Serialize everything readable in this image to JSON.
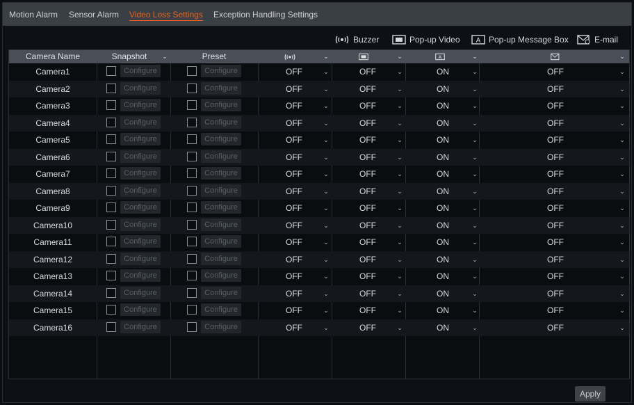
{
  "tabs": [
    "Motion Alarm",
    "Sensor Alarm",
    "Video Loss Settings",
    "Exception Handling Settings"
  ],
  "legend": {
    "buzzer": "Buzzer",
    "popup_video": "Pop-up Video",
    "popup_message": "Pop-up Message Box",
    "email": "E-mail"
  },
  "table": {
    "headers": {
      "camera": "Camera Name",
      "snapshot": "Snapshot",
      "preset": "Preset"
    },
    "configure_label": "Configure",
    "rows": [
      {
        "name": "Camera1",
        "buzzer": "OFF",
        "popup_video": "OFF",
        "popup_msg": "ON",
        "email": "OFF"
      },
      {
        "name": "Camera2",
        "buzzer": "OFF",
        "popup_video": "OFF",
        "popup_msg": "ON",
        "email": "OFF"
      },
      {
        "name": "Camera3",
        "buzzer": "OFF",
        "popup_video": "OFF",
        "popup_msg": "ON",
        "email": "OFF"
      },
      {
        "name": "Camera4",
        "buzzer": "OFF",
        "popup_video": "OFF",
        "popup_msg": "ON",
        "email": "OFF"
      },
      {
        "name": "Camera5",
        "buzzer": "OFF",
        "popup_video": "OFF",
        "popup_msg": "ON",
        "email": "OFF"
      },
      {
        "name": "Camera6",
        "buzzer": "OFF",
        "popup_video": "OFF",
        "popup_msg": "ON",
        "email": "OFF"
      },
      {
        "name": "Camera7",
        "buzzer": "OFF",
        "popup_video": "OFF",
        "popup_msg": "ON",
        "email": "OFF"
      },
      {
        "name": "Camera8",
        "buzzer": "OFF",
        "popup_video": "OFF",
        "popup_msg": "ON",
        "email": "OFF"
      },
      {
        "name": "Camera9",
        "buzzer": "OFF",
        "popup_video": "OFF",
        "popup_msg": "ON",
        "email": "OFF"
      },
      {
        "name": "Camera10",
        "buzzer": "OFF",
        "popup_video": "OFF",
        "popup_msg": "ON",
        "email": "OFF"
      },
      {
        "name": "Camera11",
        "buzzer": "OFF",
        "popup_video": "OFF",
        "popup_msg": "ON",
        "email": "OFF"
      },
      {
        "name": "Camera12",
        "buzzer": "OFF",
        "popup_video": "OFF",
        "popup_msg": "ON",
        "email": "OFF"
      },
      {
        "name": "Camera13",
        "buzzer": "OFF",
        "popup_video": "OFF",
        "popup_msg": "ON",
        "email": "OFF"
      },
      {
        "name": "Camera14",
        "buzzer": "OFF",
        "popup_video": "OFF",
        "popup_msg": "ON",
        "email": "OFF"
      },
      {
        "name": "Camera15",
        "buzzer": "OFF",
        "popup_video": "OFF",
        "popup_msg": "ON",
        "email": "OFF"
      },
      {
        "name": "Camera16",
        "buzzer": "OFF",
        "popup_video": "OFF",
        "popup_msg": "ON",
        "email": "OFF"
      }
    ]
  },
  "apply_label": "Apply",
  "colors": {
    "accent": "#e8641e",
    "tab_bar": "#3a3f46",
    "header": "#4a4f57",
    "background": "#0d1014"
  }
}
